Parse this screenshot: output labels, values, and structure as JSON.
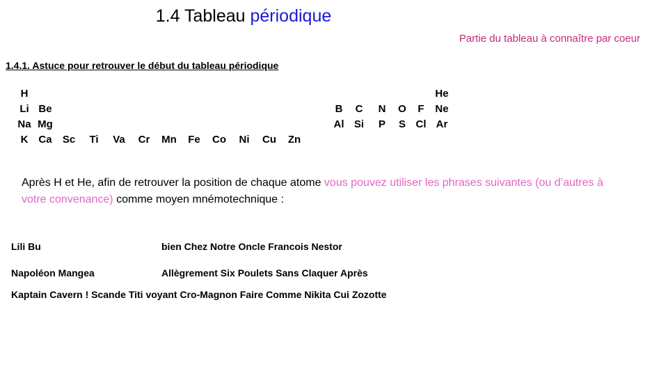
{
  "slide": {
    "title": {
      "black_part": "1.4 Tableau ",
      "blue_part": "périodique"
    },
    "callout": "Partie du tableau à connaître par coeur",
    "subheading": "1.4.1. Astuce pour retrouver le début du tableau périodique",
    "periodic_fragment": {
      "left_block": {
        "row1": [
          "H"
        ],
        "row2": [
          "Li",
          "Be"
        ],
        "row3": [
          "Na",
          "Mg"
        ],
        "row4": [
          "K",
          "Ca",
          "Sc",
          "Ti",
          "Va",
          "Cr",
          "Mn",
          "Fe",
          "Co",
          "Ni",
          "Cu",
          "Zn"
        ]
      },
      "right_block": {
        "row1": [
          "He"
        ],
        "row2": [
          "B",
          "C",
          "N",
          "O",
          "F",
          "Ne"
        ],
        "row3": [
          "Al",
          "Si",
          "P",
          "S",
          "Cl",
          "Ar"
        ]
      }
    },
    "paragraph": {
      "part1": "Après H et He, afin de retrouver la position de chaque atome ",
      "part2_pink": "vous pouvez utiliser les phrases suivantes (ou d’autres à votre convenance)",
      "part3": " comme moyen mnémotechnique :"
    },
    "mnemonics": [
      {
        "col_a": "Lili Bu",
        "col_b": "bien Chez Notre Oncle Francois Nestor"
      },
      {
        "col_a": "Napoléon Mangea",
        "col_b": "Allègrement Six Poulets Sans Claquer Après"
      },
      {
        "full": "Kaptain Cavern ! Scande Titi voyant Cro-Magnon Faire Comme Nikita Cui Zozotte"
      }
    ],
    "colors": {
      "title_blue": "#1a1ad6",
      "callout_pink": "#c42a73",
      "paragraph_pink": "#df66c4",
      "text_black": "#000000",
      "background": "#ffffff"
    }
  }
}
